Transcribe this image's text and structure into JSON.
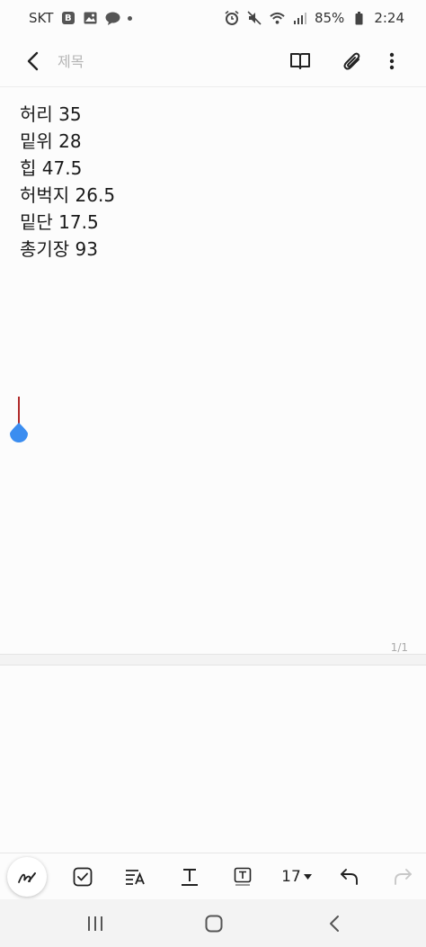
{
  "status_bar": {
    "carrier": "SKT",
    "battery": "85%",
    "time": "2:24",
    "icons": [
      "b-icon",
      "image-icon",
      "talk-icon",
      "dot-icon",
      "alarm-icon",
      "mute-icon",
      "wifi-icon",
      "signal-icon",
      "battery-icon"
    ]
  },
  "app_bar": {
    "title_placeholder": "제목",
    "title_value": "",
    "icons": [
      "back-arrow-icon",
      "book-view-icon",
      "paperclip-icon",
      "more-vertical-icon"
    ]
  },
  "note": {
    "lines": [
      "허리 35",
      "밑위 28",
      "힙 47.5",
      "허벅지 26.5",
      "밑단 17.5",
      "총기장 93"
    ]
  },
  "page_indicator": "1/1",
  "toolbar": {
    "font_size": "17",
    "icons": [
      "handwriting-pen-icon",
      "checkbox-icon",
      "text-style-icon",
      "text-format-icon",
      "text-box-icon",
      "dropdown-arrow-icon",
      "undo-icon",
      "redo-icon"
    ]
  },
  "colors": {
    "cursor": "#b02a2a",
    "handle": "#3b8df0",
    "background": "#fcfcfc"
  }
}
